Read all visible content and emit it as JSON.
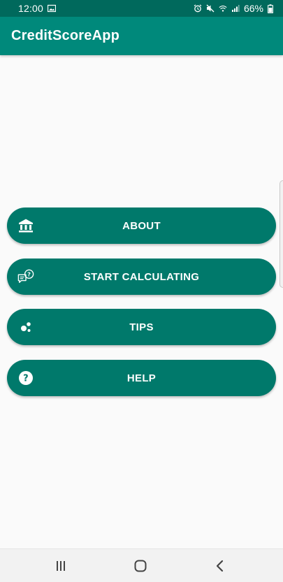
{
  "status_bar": {
    "time": "12:00",
    "battery": "66%",
    "icons": [
      "image-icon",
      "alarm-icon",
      "mute-icon",
      "wifi-icon",
      "signal-icon",
      "battery-icon"
    ]
  },
  "app_bar": {
    "title": "CreditScoreApp"
  },
  "menu": {
    "buttons": [
      {
        "label": "ABOUT",
        "icon": "bank-icon"
      },
      {
        "label": "START CALCULATING",
        "icon": "chat-question-icon"
      },
      {
        "label": "TIPS",
        "icon": "bubbles-icon"
      },
      {
        "label": "HELP",
        "icon": "help-circle-icon"
      }
    ]
  },
  "nav_bar": {
    "icons": [
      "recent-apps-icon",
      "home-icon",
      "back-icon"
    ]
  },
  "colors": {
    "status_bar": "#00695c",
    "app_bar": "#00897b",
    "button": "#00796b",
    "background": "#fafafa",
    "nav_bar": "#f2f2f2"
  }
}
